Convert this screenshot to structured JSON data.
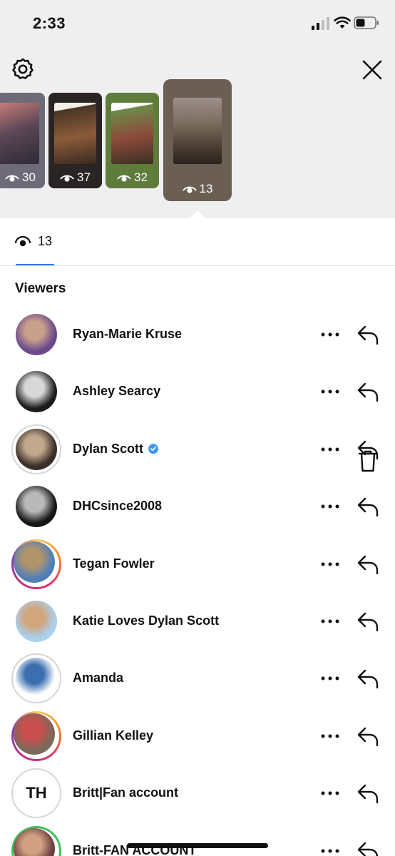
{
  "status_bar": {
    "time": "2:33"
  },
  "header": {
    "settings_icon": "gear-icon",
    "close_icon": "close-icon"
  },
  "stories": [
    {
      "views": "30"
    },
    {
      "views": "37"
    },
    {
      "views": "32"
    },
    {
      "views": "13",
      "selected": true
    }
  ],
  "stats": {
    "view_count": "13",
    "tab_icon": "eye-icon",
    "delete_icon": "trash-icon"
  },
  "viewers": {
    "title": "Viewers",
    "items": [
      {
        "name": "Ryan-Marie Kruse",
        "ring": "none",
        "colors": [
          "#6a4a8c",
          "#c9a08a"
        ]
      },
      {
        "name": "Ashley Searcy",
        "ring": "none",
        "colors": [
          "#1c1c1c",
          "#d8d8d8"
        ]
      },
      {
        "name": "Dylan Scott",
        "ring": "grey",
        "verified": true,
        "colors": [
          "#3a2e28",
          "#c2a88c"
        ]
      },
      {
        "name": "DHCsince2008",
        "ring": "none",
        "colors": [
          "#151515",
          "#b9b9b9"
        ]
      },
      {
        "name": "Tegan Fowler",
        "ring": "ig",
        "colors": [
          "#4f7fb8",
          "#b0946c"
        ]
      },
      {
        "name": "Katie Loves Dylan Scott",
        "ring": "none",
        "colors": [
          "#a9d0ee",
          "#d1a67d"
        ]
      },
      {
        "name": "Amanda",
        "ring": "grey",
        "colors": [
          "#ffffff",
          "#3c6fb0"
        ]
      },
      {
        "name": "Gillian Kelley",
        "ring": "ig",
        "colors": [
          "#7a6a5a",
          "#c94f4f"
        ]
      },
      {
        "name": "Britt|Fan account",
        "ring": "grey",
        "initials": "TH",
        "colors": [
          "#ffffff",
          "#ffffff"
        ]
      },
      {
        "name": "Britt-FAN ACCOUNT",
        "ring": "green",
        "colors": [
          "#6a4040",
          "#d0a080"
        ]
      }
    ]
  }
}
